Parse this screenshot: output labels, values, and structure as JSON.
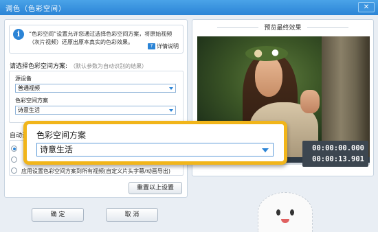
{
  "window": {
    "title": "调色（色彩空间）",
    "close_glyph": "✕"
  },
  "info": {
    "icon_glyph": "i",
    "text": "“色彩空间”设置允许您通过选择色彩空间方案，将原始视频（灰片视频）还原出原本真实的色彩效果。",
    "help_icon_glyph": "?",
    "help_label": "详情说明"
  },
  "scheme": {
    "heading": "请选择色彩空间方案:",
    "hint": "（默认参数为自动识别的结果）",
    "source_label": "源设备",
    "source_value": "普通视频",
    "color_space_label": "色彩空间方案",
    "color_space_value": "诗意生活"
  },
  "auto": {
    "heading": "自动调",
    "option_3": "应用设置色彩空间方案到所有视频(自定义片头字幕/动画导出)"
  },
  "buttons": {
    "reset": "重置以上设置",
    "ok": "确 定",
    "cancel": "取 消"
  },
  "preview": {
    "title": "预览最终效果",
    "current_time": "00:00:00.000",
    "total_time": "00:00:13.901",
    "progress": 0.0
  },
  "callout": {
    "label": "色彩空间方案",
    "value": "诗意生活"
  },
  "colors": {
    "accent": "#2b84d6",
    "callout_border": "#f1b51a"
  }
}
